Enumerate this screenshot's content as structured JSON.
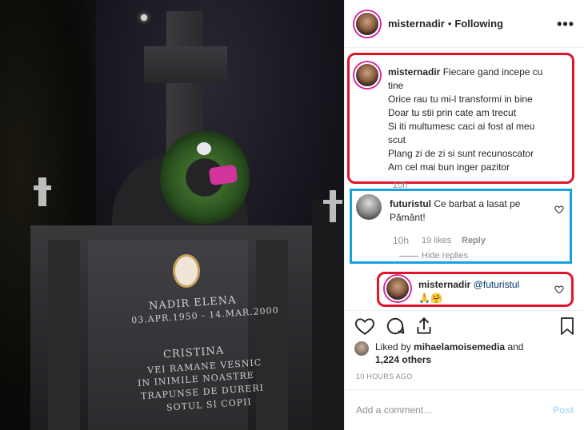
{
  "post": {
    "username": "misternadir",
    "separator": "•",
    "follow_status": "Following",
    "more_label": "•••"
  },
  "caption": {
    "username": "misternadir",
    "lines": [
      "Fiecare gand incepe cu",
      "tine",
      "Orice rau tu mi-l transformi in bine",
      "Doar tu stii prin cate am trecut",
      "Si iti multumesc caci ai fost al meu",
      "scut",
      "Plang zi de zi si sunt recunoscator",
      "Am cel mai bun inger pazitor"
    ],
    "time": "10h"
  },
  "comment": {
    "username": "futuristul",
    "text_line1": "Ce barbat a lasat pe",
    "text_line2": "Pământ!",
    "time": "10h",
    "likes": "19 likes",
    "reply": "Reply",
    "hide_replies": "Hide replies"
  },
  "reply": {
    "username": "misternadir",
    "mention": "@futuristul",
    "emoji": "🙏🤗"
  },
  "likes": {
    "prefix": "Liked by",
    "user": "mihaelamoisemedia",
    "conj": "and",
    "others": "1,224 others"
  },
  "timestamp": "10 HOURS AGO",
  "add_comment": {
    "placeholder": "Add a comment…",
    "post_label": "Post"
  },
  "photo": {
    "inscription_name": "NADIR ELENA",
    "inscription_dates": "03.APR.1950 - 14.MAR.2000",
    "inscription_2": "CRISTINA",
    "inscription_3": "VEI RAMANE VESNIC",
    "inscription_4": "IN INIMILE NOASTRE",
    "inscription_5": "TRAPUNSE DE DURERI",
    "inscription_6": "SOTUL SI COPII"
  },
  "colors": {
    "highlight_red": "#e0142a",
    "highlight_blue": "#1aa0e0",
    "post_disabled": "#b3dbff",
    "meta_gray": "#8e8e8e"
  },
  "icons": [
    "heart-icon",
    "comment-icon",
    "share-icon",
    "bookmark-icon",
    "more-icon",
    "small-heart-icon"
  ]
}
